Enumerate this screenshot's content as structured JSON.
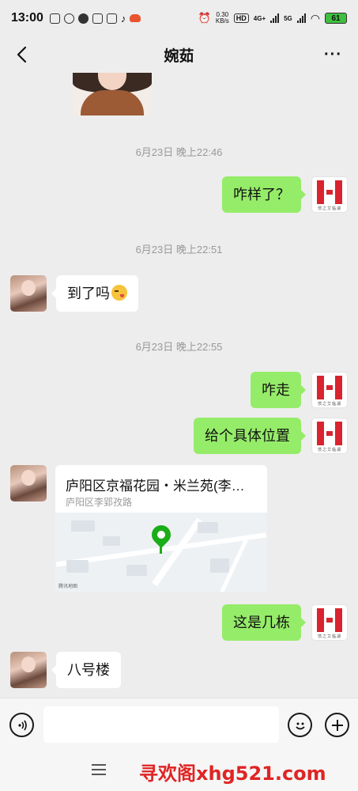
{
  "status_bar": {
    "time": "13:00",
    "net_speed_value": "0.30",
    "net_speed_unit": "KB/s",
    "hd_label": "HD",
    "signal1_label": "4G+",
    "signal2_label": "5G",
    "battery": "61"
  },
  "header": {
    "back_icon": "chevron-left-icon",
    "title": "婉茹",
    "more_label": "···"
  },
  "messages": [
    {
      "type": "timestamp",
      "text": "6月23日 晚上22:46"
    },
    {
      "type": "text",
      "side": "right",
      "text": "咋样了？"
    },
    {
      "type": "timestamp",
      "text": "6月23日 晚上22:51"
    },
    {
      "type": "text",
      "side": "left",
      "text": "到了吗",
      "emoji": "wink-kiss-emoji"
    },
    {
      "type": "timestamp",
      "text": "6月23日 晚上22:55"
    },
    {
      "type": "text",
      "side": "right",
      "text": "咋走"
    },
    {
      "type": "text",
      "side": "right",
      "text": "给个具体位置"
    },
    {
      "type": "location",
      "side": "left",
      "title": "庐阳区京福花园・米兰苑(李…",
      "address": "庐阳区李郢孜路",
      "map_provider": "腾讯地图"
    },
    {
      "type": "text",
      "side": "right",
      "text": "这是几栋"
    },
    {
      "type": "text",
      "side": "left",
      "text": "八号楼"
    }
  ],
  "self_avatar_caption": "惯之艾临湖",
  "input_bar": {
    "voice_icon": "voice-icon",
    "emoji_icon": "emoji-icon",
    "plus_icon": "plus-icon",
    "value": ""
  },
  "navigation": {
    "menu_icon": "menu-icon",
    "watermark": "寻欢阁xhg521.com"
  },
  "colors": {
    "background": "#ededed",
    "bubble_self": "#95ec69",
    "bubble_other": "#ffffff",
    "timestamp": "#999999",
    "watermark": "#e02424"
  }
}
